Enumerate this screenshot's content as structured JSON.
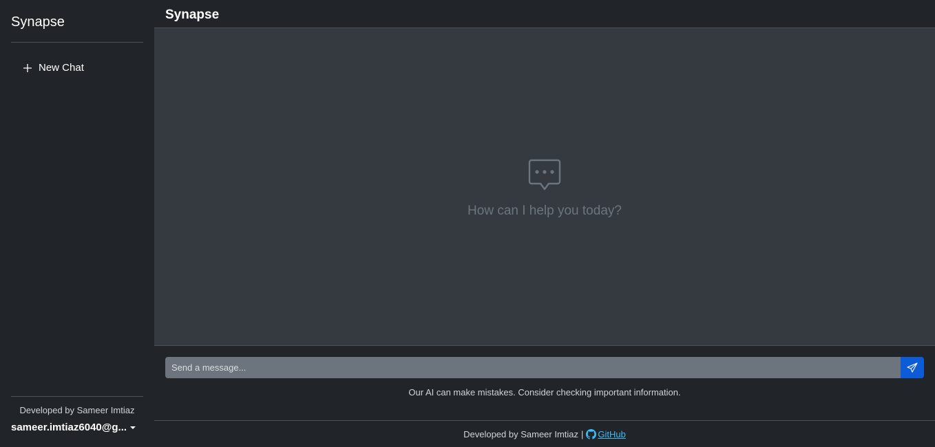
{
  "sidebar": {
    "title": "Synapse",
    "new_chat_label": "New Chat",
    "developer_text": "Developed by Sameer Imtiaz",
    "account_email": "sameer.imtiaz6040@g..."
  },
  "header": {
    "title": "Synapse"
  },
  "chat": {
    "empty_message": "How can I help you today?",
    "icon": "chat-dots-icon"
  },
  "composer": {
    "placeholder": "Send a message...",
    "value": "",
    "send_icon": "send-icon",
    "disclaimer": "Our AI can make mistakes. Consider checking important information."
  },
  "footer": {
    "developer_text": "Developed by Sameer Imtiaz",
    "separator": "|",
    "github_label": "GitHub",
    "github_icon": "github-icon"
  },
  "colors": {
    "background": "#212529",
    "chat_area": "#343a40",
    "input_bg": "#6c757d",
    "accent": "#0d5bd7",
    "link": "#3dbbf5"
  }
}
